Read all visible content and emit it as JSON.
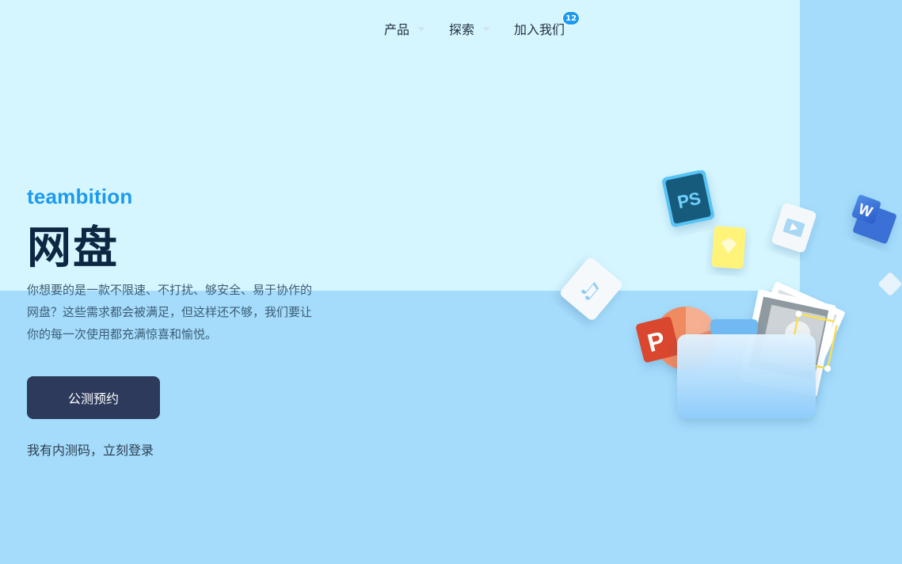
{
  "nav": {
    "items": [
      {
        "label": "产品",
        "has_dropdown": true
      },
      {
        "label": "探索",
        "has_dropdown": true
      },
      {
        "label": "加入我们",
        "badge": "12"
      }
    ]
  },
  "hero": {
    "brand": "teambition",
    "title": "网盘",
    "description": "你想要的是一款不限速、不打扰、够安全、易于协作的网盘？这些需求都会被满足，但这样还不够，我们要让你的每一次使用都充满惊喜和愉悦。",
    "cta_label": "公测预约",
    "login_link": "我有内测码，立刻登录"
  },
  "illustration": {
    "ps_label": "PS",
    "ppt_label": "P",
    "word_label": "W",
    "icons": [
      "photoshop-file-icon",
      "sketch-file-icon",
      "video-file-icon",
      "word-file-icon",
      "music-file-icon",
      "powerpoint-file-icon",
      "photo-stack-icon",
      "folder-icon"
    ]
  },
  "colors": {
    "background_light": "#d6f6ff",
    "background_blue": "#a5dcfb",
    "brand": "#1b9aee",
    "title": "#0d2742",
    "cta_bg": "#2d3a5c"
  }
}
